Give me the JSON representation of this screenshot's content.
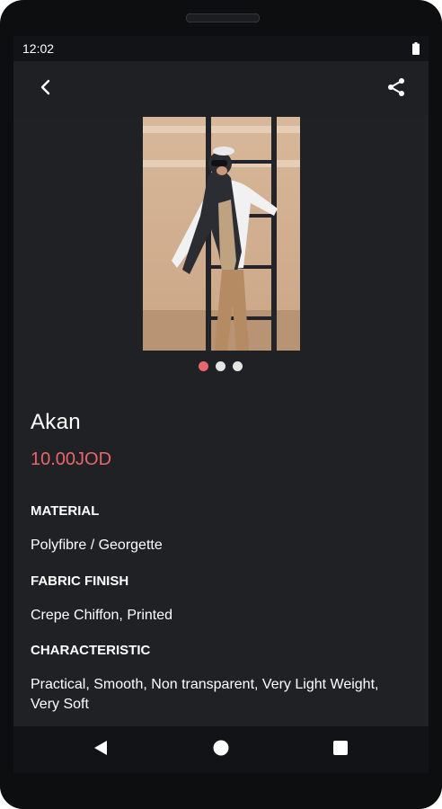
{
  "status_bar": {
    "time": "12:02"
  },
  "product": {
    "name": "Akan",
    "price": "10.00JOD",
    "images": {
      "count": 3,
      "active_index": 0
    }
  },
  "details": [
    {
      "label": "MATERIAL",
      "value": "Polyfibre / Georgette"
    },
    {
      "label": "FABRIC FINISH",
      "value": "Crepe Chiffon, Printed"
    },
    {
      "label": "CHARACTERISTIC",
      "value": "Practical, Smooth, Non transparent, Very Light Weight, Very Soft"
    }
  ],
  "icons": {
    "back": "back-arrow-icon",
    "share": "share-icon",
    "nav_back": "triangle-back-icon",
    "nav_home": "circle-home-icon",
    "nav_recents": "square-recents-icon",
    "battery": "battery-icon"
  },
  "colors": {
    "accent": "#e8676a",
    "background": "#202125",
    "bars": "#121316",
    "text": "#ffffff"
  }
}
